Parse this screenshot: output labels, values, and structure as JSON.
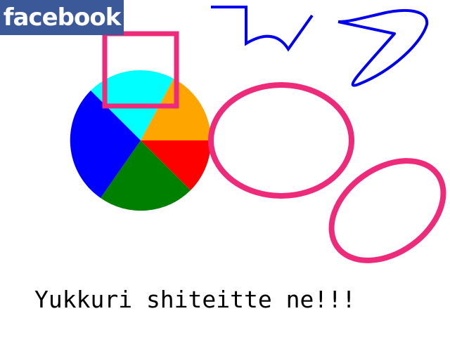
{
  "logo": {
    "text": "facebook",
    "background": "#3b5998",
    "color": "#ffffff"
  },
  "caption": {
    "text": "Yukkuri shiteitte ne!!!"
  },
  "colors": {
    "pie_cyan": "#00ffff",
    "pie_orange": "#ffa500",
    "pie_red": "#ff0000",
    "pie_green": "#008000",
    "pie_blue": "#0000ff",
    "pink_stroke": "#ee2a7b",
    "blue_stroke": "#0000ee"
  },
  "icons": [
    "facebook-logo",
    "pie-shape",
    "square-outline",
    "ellipse-outline",
    "zigzag-line",
    "bezier-curve"
  ]
}
